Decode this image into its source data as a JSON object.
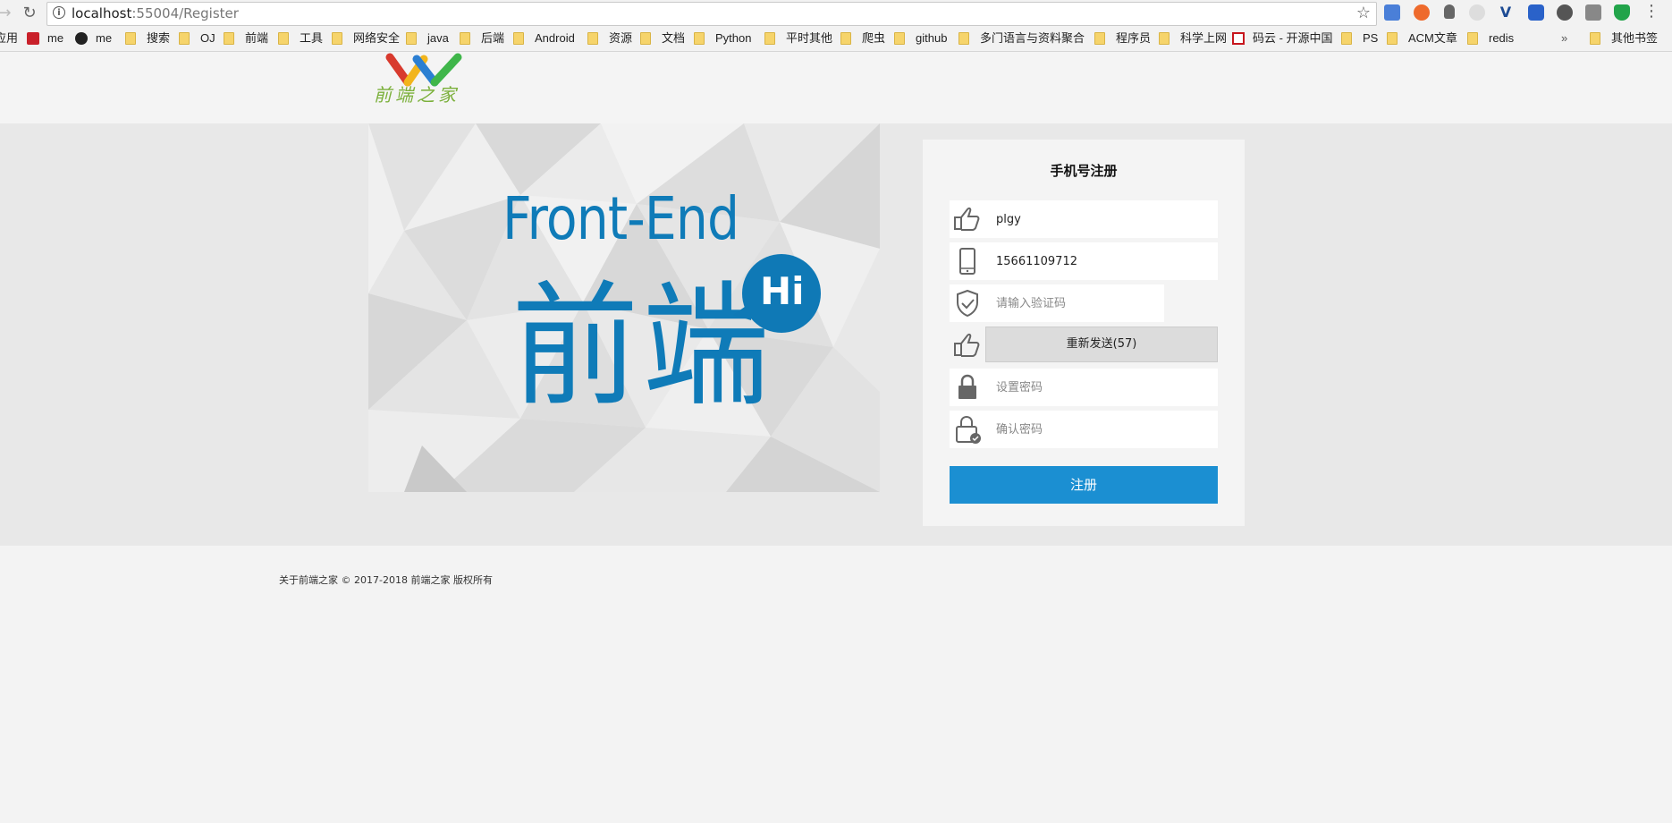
{
  "browser": {
    "url_host": "localhost",
    "url_rest": ":55004/Register",
    "bookmarks": [
      {
        "label": "应用",
        "icon": "apps-icon"
      },
      {
        "label": "me",
        "icon": "csdn-icon"
      },
      {
        "label": "me",
        "icon": "github-icon"
      },
      {
        "label": "搜索",
        "icon": "folder-icon"
      },
      {
        "label": "OJ",
        "icon": "folder-icon"
      },
      {
        "label": "前端",
        "icon": "folder-icon"
      },
      {
        "label": "工具",
        "icon": "folder-icon"
      },
      {
        "label": "网络安全",
        "icon": "folder-icon"
      },
      {
        "label": "java",
        "icon": "folder-icon"
      },
      {
        "label": "后端",
        "icon": "folder-icon"
      },
      {
        "label": "Android",
        "icon": "folder-icon"
      },
      {
        "label": "资源",
        "icon": "folder-icon"
      },
      {
        "label": "文档",
        "icon": "folder-icon"
      },
      {
        "label": "Python",
        "icon": "folder-icon"
      },
      {
        "label": "平时其他",
        "icon": "folder-icon"
      },
      {
        "label": "爬虫",
        "icon": "folder-icon"
      },
      {
        "label": "github",
        "icon": "folder-icon"
      },
      {
        "label": "多门语言与资料聚合",
        "icon": "folder-icon"
      },
      {
        "label": "程序员",
        "icon": "folder-icon"
      },
      {
        "label": "科学上网",
        "icon": "folder-icon"
      },
      {
        "label": "码云 - 开源中国",
        "icon": "gitee-icon"
      },
      {
        "label": "PS",
        "icon": "folder-icon"
      },
      {
        "label": "ACM文章",
        "icon": "folder-icon"
      },
      {
        "label": "redis",
        "icon": "folder-icon"
      }
    ],
    "overflow": "»",
    "other_bookmarks": "其他书签"
  },
  "site": {
    "logo_text": "前端之家",
    "banner_en": "Front-End",
    "banner_cn": "前端",
    "banner_hi": "Hi"
  },
  "form": {
    "title": "手机号注册",
    "username_value": "plgy",
    "phone_value": "15661109712",
    "code_placeholder": "请输入验证码",
    "resend_label": "重新发送(57)",
    "password_placeholder": "设置密码",
    "confirm_placeholder": "确认密码",
    "submit_label": "注册"
  },
  "footer": {
    "text": "关于前端之家 © 2017-2018 前端之家 版权所有"
  },
  "colors": {
    "accent": "#1b8fd2",
    "banner_blue": "#0f7bb8",
    "logo_green": "#7bb03b"
  }
}
